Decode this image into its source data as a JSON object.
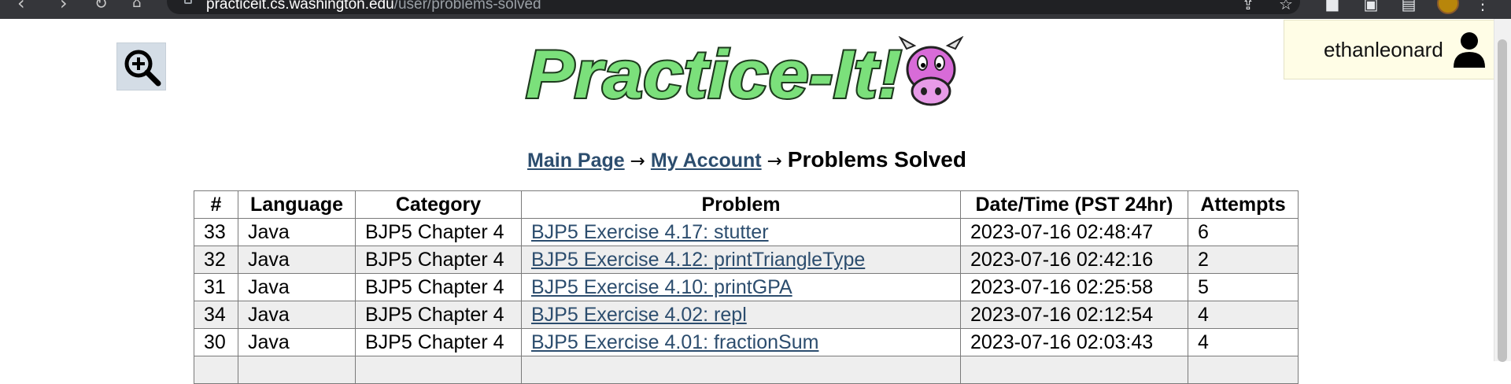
{
  "browser": {
    "url_host": "practiceit.cs.washington.edu",
    "url_path": "/user/problems-solved"
  },
  "header": {
    "logo_text": "Practice-It!",
    "zoom_icon": "zoom-in-icon",
    "user_icon": "user-icon",
    "username": "ethanleonard"
  },
  "breadcrumb": {
    "main_page": "Main Page",
    "arrow": "→",
    "my_account": "My Account",
    "current": "Problems Solved"
  },
  "table": {
    "headers": [
      "#",
      "Language",
      "Category",
      "Problem",
      "Date/Time (PST 24hr)",
      "Attempts"
    ],
    "rows": [
      {
        "num": "33",
        "language": "Java",
        "category": "BJP5 Chapter 4",
        "problem": "BJP5 Exercise 4.17: stutter",
        "datetime": "2023-07-16 02:48:47",
        "attempts": "6"
      },
      {
        "num": "32",
        "language": "Java",
        "category": "BJP5 Chapter 4",
        "problem": "BJP5 Exercise 4.12: printTriangleType",
        "datetime": "2023-07-16 02:42:16",
        "attempts": "2"
      },
      {
        "num": "31",
        "language": "Java",
        "category": "BJP5 Chapter 4",
        "problem": "BJP5 Exercise 4.10: printGPA",
        "datetime": "2023-07-16 02:25:58",
        "attempts": "5"
      },
      {
        "num": "34",
        "language": "Java",
        "category": "BJP5 Chapter 4",
        "problem": "BJP5 Exercise 4.02: repl",
        "datetime": "2023-07-16 02:12:54",
        "attempts": "4"
      },
      {
        "num": "30",
        "language": "Java",
        "category": "BJP5 Chapter 4",
        "problem": "BJP5 Exercise 4.01: fractionSum",
        "datetime": "2023-07-16 02:03:43",
        "attempts": "4"
      }
    ]
  },
  "colors": {
    "link": "#2c4d6e",
    "user_box_bg": "#fffde6",
    "zoom_bg": "#d4dde6",
    "row_alt_bg": "#eeeeee",
    "logo_green": "#7be07b",
    "cow_purple": "#d86bd8"
  }
}
